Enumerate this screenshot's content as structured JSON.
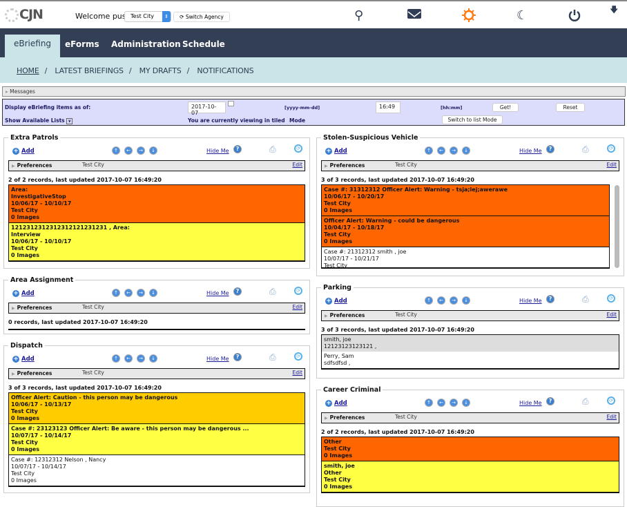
{
  "header": {
    "logo_text": "CJN",
    "welcome": "Welcome puser",
    "agency_select": "Test City",
    "switch_agency": "Switch Agency",
    "icons": [
      "search-icon",
      "mail-icon",
      "sun-icon",
      "moon-icon",
      "power-icon",
      "download-arrow-icon"
    ],
    "accent_color": "#ff7a10"
  },
  "nav": {
    "tabs": [
      "eBriefing",
      "eForms",
      "Administration",
      "Schedule"
    ],
    "active": "eBriefing"
  },
  "subnav": {
    "items": [
      "HOME",
      "LATEST BRIEFINGS",
      "MY DRAFTS",
      "NOTIFICATIONS"
    ],
    "separator": "/"
  },
  "messages": "Messages",
  "filters": {
    "display_label": "Display eBriefing items as of:",
    "date_value": "2017-10-07",
    "date_format": "[yyyy-mm-dd]",
    "time_value": "16:49",
    "time_format": "[hh:mm]",
    "get_button": "Get!",
    "reset_button": "Reset",
    "show_lists": "Show Available Lists",
    "viewing_text": "You are currently viewing in tiled",
    "mode_text": "Mode",
    "switch_mode": "Switch to list Mode"
  },
  "panel_common": {
    "add": "Add",
    "hide": "Hide Me",
    "preferences": "Preferences",
    "edit": "Edit"
  },
  "panels": [
    {
      "title": "Extra Patrols",
      "pref_value": "Test City",
      "status": "2 of 2 records, last updated 2017-10-07 16:49:20",
      "records": [
        {
          "color": "#ff6600",
          "bold": true,
          "lines": [
            "Area:",
            "InvestigativeStop",
            "10/06/17 - 10/10/17",
            "Test City",
            "0 Images"
          ]
        },
        {
          "color": "#ffff44",
          "bold": true,
          "lines": [
            "1212312312312312121231231 , Area:",
            "Interview",
            "10/06/17 - 10/10/17",
            "Test City",
            "0 Images"
          ]
        }
      ]
    },
    {
      "title": "Area Assignment",
      "pref_value": "Test City",
      "status": "0 records, last updated 2017-10-07 16:49:20",
      "records": []
    },
    {
      "title": "Dispatch",
      "pref_value": "Test City",
      "status": "3 of 3 records, last updated 2017-10-07 16:49:20",
      "records": [
        {
          "color": "#ffcc00",
          "bold": true,
          "lines": [
            "Officer Alert: Caution - this person may be dangerous",
            "10/06/17 - 10/13/17",
            "Test City",
            "0 Images"
          ]
        },
        {
          "color": "#ffff44",
          "bold": true,
          "lines": [
            "Case #: 23123123 Officer Alert: Be aware - this person may be dangerous ...",
            "10/07/17 - 10/14/17",
            "Test City",
            "0 Images"
          ]
        },
        {
          "color": "#ffffff",
          "bold": false,
          "lines": [
            "Case #: 12312312 Nelson , Nancy",
            "10/07/17 - 10/14/17",
            "Test City",
            "0 Images"
          ]
        }
      ]
    },
    {
      "title": "Stolen-Suspicious Vehicle",
      "pref_value": "Test City",
      "status": "3 of 3 records, last updated 2017-10-07 16:49:20",
      "records": [
        {
          "color": "#ff6600",
          "bold": true,
          "lines": [
            "Case #: 31312312 Officer Alert: Warning - tsja;lej;awerawe",
            "10/06/17 - 10/20/17",
            "Test City",
            "0 Images"
          ]
        },
        {
          "color": "#ff6600",
          "bold": true,
          "lines": [
            "Officer Alert: Warning - could be dangerous",
            "10/04/17 - 10/18/17",
            "Test City",
            "0 Images"
          ]
        },
        {
          "color": "#ffffff",
          "bold": false,
          "lines": [
            "Case #: 21312312 smith , joe",
            "10/07/17 - 10/21/17",
            "Test City"
          ]
        }
      ]
    },
    {
      "title": "Parking",
      "pref_value": "Test City",
      "status": "3 of 3 records, last updated 2017-10-07 16:49:20",
      "records": [
        {
          "color": "#dddddd",
          "bold": false,
          "lines": [
            "smith, joe",
            "12123123123121 ,"
          ]
        },
        {
          "color": "#ffffff",
          "bold": false,
          "lines": [
            "Perry, Sam",
            "sdfsdfsd ,"
          ]
        }
      ]
    },
    {
      "title": "Career Criminal",
      "pref_value": "Test City",
      "status": "2 of 2 records, last updated 2017-10-07 16:49:20",
      "records": [
        {
          "color": "#ff6600",
          "bold": true,
          "lines": [
            "Other",
            "Test City",
            "0 Images"
          ]
        },
        {
          "color": "#ffff44",
          "bold": true,
          "lines": [
            "smith, joe",
            "Other",
            "Test City",
            "0 Images"
          ]
        }
      ]
    }
  ]
}
